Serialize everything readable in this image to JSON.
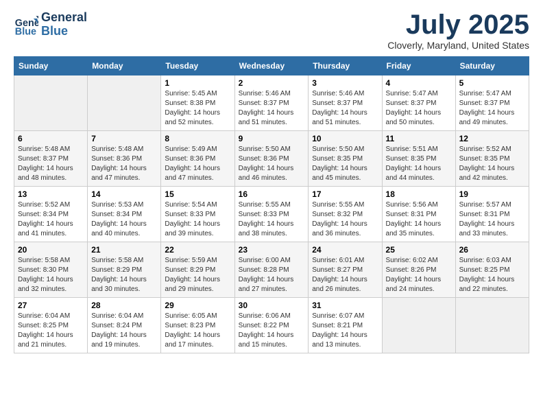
{
  "logo": {
    "line1": "General",
    "line2": "Blue"
  },
  "title": "July 2025",
  "location": "Cloverly, Maryland, United States",
  "days_of_week": [
    "Sunday",
    "Monday",
    "Tuesday",
    "Wednesday",
    "Thursday",
    "Friday",
    "Saturday"
  ],
  "weeks": [
    [
      {
        "num": "",
        "sunrise": "",
        "sunset": "",
        "daylight": ""
      },
      {
        "num": "",
        "sunrise": "",
        "sunset": "",
        "daylight": ""
      },
      {
        "num": "1",
        "sunrise": "Sunrise: 5:45 AM",
        "sunset": "Sunset: 8:38 PM",
        "daylight": "Daylight: 14 hours and 52 minutes."
      },
      {
        "num": "2",
        "sunrise": "Sunrise: 5:46 AM",
        "sunset": "Sunset: 8:37 PM",
        "daylight": "Daylight: 14 hours and 51 minutes."
      },
      {
        "num": "3",
        "sunrise": "Sunrise: 5:46 AM",
        "sunset": "Sunset: 8:37 PM",
        "daylight": "Daylight: 14 hours and 51 minutes."
      },
      {
        "num": "4",
        "sunrise": "Sunrise: 5:47 AM",
        "sunset": "Sunset: 8:37 PM",
        "daylight": "Daylight: 14 hours and 50 minutes."
      },
      {
        "num": "5",
        "sunrise": "Sunrise: 5:47 AM",
        "sunset": "Sunset: 8:37 PM",
        "daylight": "Daylight: 14 hours and 49 minutes."
      }
    ],
    [
      {
        "num": "6",
        "sunrise": "Sunrise: 5:48 AM",
        "sunset": "Sunset: 8:37 PM",
        "daylight": "Daylight: 14 hours and 48 minutes."
      },
      {
        "num": "7",
        "sunrise": "Sunrise: 5:48 AM",
        "sunset": "Sunset: 8:36 PM",
        "daylight": "Daylight: 14 hours and 47 minutes."
      },
      {
        "num": "8",
        "sunrise": "Sunrise: 5:49 AM",
        "sunset": "Sunset: 8:36 PM",
        "daylight": "Daylight: 14 hours and 47 minutes."
      },
      {
        "num": "9",
        "sunrise": "Sunrise: 5:50 AM",
        "sunset": "Sunset: 8:36 PM",
        "daylight": "Daylight: 14 hours and 46 minutes."
      },
      {
        "num": "10",
        "sunrise": "Sunrise: 5:50 AM",
        "sunset": "Sunset: 8:35 PM",
        "daylight": "Daylight: 14 hours and 45 minutes."
      },
      {
        "num": "11",
        "sunrise": "Sunrise: 5:51 AM",
        "sunset": "Sunset: 8:35 PM",
        "daylight": "Daylight: 14 hours and 44 minutes."
      },
      {
        "num": "12",
        "sunrise": "Sunrise: 5:52 AM",
        "sunset": "Sunset: 8:35 PM",
        "daylight": "Daylight: 14 hours and 42 minutes."
      }
    ],
    [
      {
        "num": "13",
        "sunrise": "Sunrise: 5:52 AM",
        "sunset": "Sunset: 8:34 PM",
        "daylight": "Daylight: 14 hours and 41 minutes."
      },
      {
        "num": "14",
        "sunrise": "Sunrise: 5:53 AM",
        "sunset": "Sunset: 8:34 PM",
        "daylight": "Daylight: 14 hours and 40 minutes."
      },
      {
        "num": "15",
        "sunrise": "Sunrise: 5:54 AM",
        "sunset": "Sunset: 8:33 PM",
        "daylight": "Daylight: 14 hours and 39 minutes."
      },
      {
        "num": "16",
        "sunrise": "Sunrise: 5:55 AM",
        "sunset": "Sunset: 8:33 PM",
        "daylight": "Daylight: 14 hours and 38 minutes."
      },
      {
        "num": "17",
        "sunrise": "Sunrise: 5:55 AM",
        "sunset": "Sunset: 8:32 PM",
        "daylight": "Daylight: 14 hours and 36 minutes."
      },
      {
        "num": "18",
        "sunrise": "Sunrise: 5:56 AM",
        "sunset": "Sunset: 8:31 PM",
        "daylight": "Daylight: 14 hours and 35 minutes."
      },
      {
        "num": "19",
        "sunrise": "Sunrise: 5:57 AM",
        "sunset": "Sunset: 8:31 PM",
        "daylight": "Daylight: 14 hours and 33 minutes."
      }
    ],
    [
      {
        "num": "20",
        "sunrise": "Sunrise: 5:58 AM",
        "sunset": "Sunset: 8:30 PM",
        "daylight": "Daylight: 14 hours and 32 minutes."
      },
      {
        "num": "21",
        "sunrise": "Sunrise: 5:58 AM",
        "sunset": "Sunset: 8:29 PM",
        "daylight": "Daylight: 14 hours and 30 minutes."
      },
      {
        "num": "22",
        "sunrise": "Sunrise: 5:59 AM",
        "sunset": "Sunset: 8:29 PM",
        "daylight": "Daylight: 14 hours and 29 minutes."
      },
      {
        "num": "23",
        "sunrise": "Sunrise: 6:00 AM",
        "sunset": "Sunset: 8:28 PM",
        "daylight": "Daylight: 14 hours and 27 minutes."
      },
      {
        "num": "24",
        "sunrise": "Sunrise: 6:01 AM",
        "sunset": "Sunset: 8:27 PM",
        "daylight": "Daylight: 14 hours and 26 minutes."
      },
      {
        "num": "25",
        "sunrise": "Sunrise: 6:02 AM",
        "sunset": "Sunset: 8:26 PM",
        "daylight": "Daylight: 14 hours and 24 minutes."
      },
      {
        "num": "26",
        "sunrise": "Sunrise: 6:03 AM",
        "sunset": "Sunset: 8:25 PM",
        "daylight": "Daylight: 14 hours and 22 minutes."
      }
    ],
    [
      {
        "num": "27",
        "sunrise": "Sunrise: 6:04 AM",
        "sunset": "Sunset: 8:25 PM",
        "daylight": "Daylight: 14 hours and 21 minutes."
      },
      {
        "num": "28",
        "sunrise": "Sunrise: 6:04 AM",
        "sunset": "Sunset: 8:24 PM",
        "daylight": "Daylight: 14 hours and 19 minutes."
      },
      {
        "num": "29",
        "sunrise": "Sunrise: 6:05 AM",
        "sunset": "Sunset: 8:23 PM",
        "daylight": "Daylight: 14 hours and 17 minutes."
      },
      {
        "num": "30",
        "sunrise": "Sunrise: 6:06 AM",
        "sunset": "Sunset: 8:22 PM",
        "daylight": "Daylight: 14 hours and 15 minutes."
      },
      {
        "num": "31",
        "sunrise": "Sunrise: 6:07 AM",
        "sunset": "Sunset: 8:21 PM",
        "daylight": "Daylight: 14 hours and 13 minutes."
      },
      {
        "num": "",
        "sunrise": "",
        "sunset": "",
        "daylight": ""
      },
      {
        "num": "",
        "sunrise": "",
        "sunset": "",
        "daylight": ""
      }
    ]
  ]
}
